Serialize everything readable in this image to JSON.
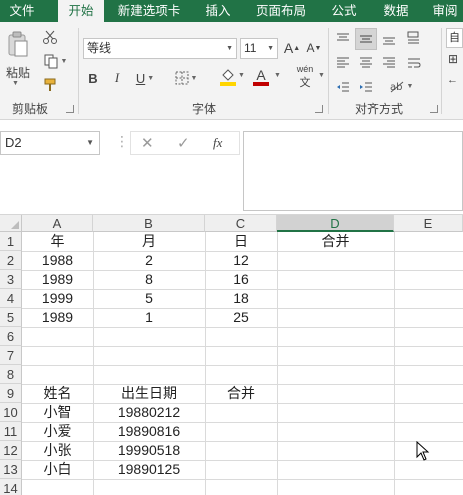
{
  "tabs": [
    {
      "label": "文件",
      "active": false
    },
    {
      "label": "开始",
      "active": true
    },
    {
      "label": "新建选项卡",
      "active": false
    },
    {
      "label": "插入",
      "active": false
    },
    {
      "label": "页面布局",
      "active": false
    },
    {
      "label": "公式",
      "active": false
    },
    {
      "label": "数据",
      "active": false
    },
    {
      "label": "审阅",
      "active": false
    }
  ],
  "ribbon": {
    "clipboard": {
      "paste_label": "粘贴",
      "group_label": "剪贴板"
    },
    "font": {
      "font_name": "等线",
      "font_size": "11",
      "group_label": "字体",
      "bold": "B",
      "italic": "I",
      "underline": "U",
      "phonetic": "wén"
    },
    "alignment": {
      "group_label": "对齐方式",
      "wrap_label": "自"
    }
  },
  "formula_bar": {
    "name_box": "D2",
    "formula": "",
    "cancel": "✕",
    "enter": "✓",
    "fx": "fx"
  },
  "sheet": {
    "columns": [
      "A",
      "B",
      "C",
      "D",
      "E"
    ],
    "selected_column": "D",
    "rows": [
      "1",
      "2",
      "3",
      "4",
      "5",
      "6",
      "7",
      "8",
      "9",
      "10",
      "11",
      "12",
      "13",
      "14"
    ],
    "cells": {
      "r1": [
        "年",
        "月",
        "日",
        "合并"
      ],
      "r2": [
        "1988",
        "2",
        "12",
        ""
      ],
      "r3": [
        "1989",
        "8",
        "16",
        ""
      ],
      "r4": [
        "1999",
        "5",
        "18",
        ""
      ],
      "r5": [
        "1989",
        "1",
        "25",
        ""
      ],
      "r9": [
        "姓名",
        "出生日期",
        "合并"
      ],
      "r10": [
        "小智",
        "19880212"
      ],
      "r11": [
        "小爱",
        "19890816"
      ],
      "r12": [
        "小张",
        "19990518"
      ],
      "r13": [
        "小白",
        "19890125"
      ]
    }
  },
  "colors": {
    "accent": "#217346",
    "ribbon_bg": "#f3f3f3",
    "font_color": "#c00000",
    "fill_color": "#ffd500"
  }
}
